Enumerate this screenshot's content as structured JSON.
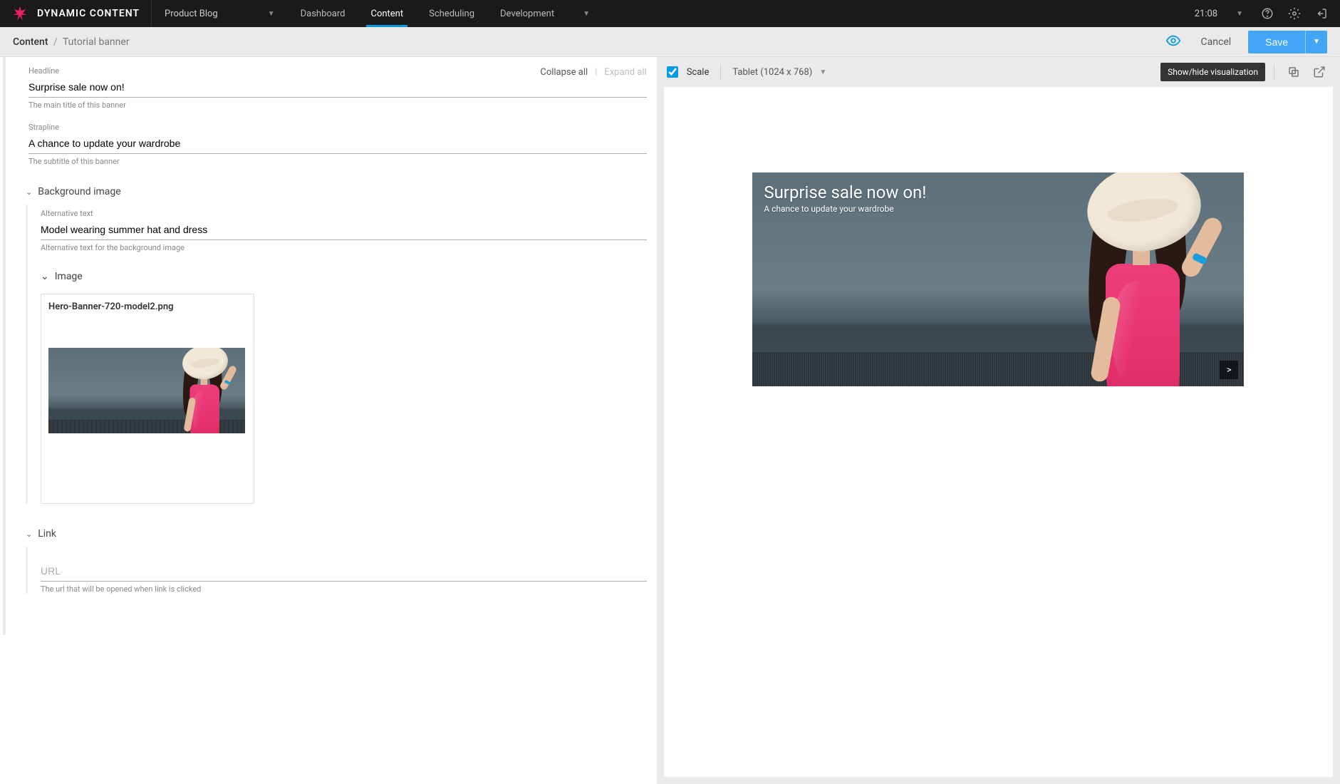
{
  "brand": "DYNAMIC CONTENT",
  "nav": {
    "workspace": "Product Blog",
    "tabs": [
      "Dashboard",
      "Content",
      "Scheduling",
      "Development"
    ],
    "active_tab": "Content"
  },
  "clock": "21:08",
  "breadcrumb": {
    "root": "Content",
    "leaf": "Tutorial banner"
  },
  "actions": {
    "cancel": "Cancel",
    "save": "Save"
  },
  "panel_controls": {
    "collapse": "Collapse all",
    "expand": "Expand all"
  },
  "fields": {
    "headline": {
      "label": "Headline",
      "value": "Surprise sale now on!",
      "help": "The main title of this banner"
    },
    "strapline": {
      "label": "Strapline",
      "value": "A chance to update your wardrobe",
      "help": "The subtitle of this banner"
    },
    "background_image": {
      "section_label": "Background image",
      "alt_text": {
        "label": "Alternative text",
        "value": "Model wearing summer hat and dress",
        "help": "Alternative text for the background image"
      },
      "image": {
        "section_label": "Image",
        "filename": "Hero-Banner-720-model2.png"
      }
    },
    "link": {
      "section_label": "Link",
      "url": {
        "placeholder": "URL",
        "value": "",
        "help": "The url that will be opened when link is clicked"
      }
    }
  },
  "preview": {
    "scale_label": "Scale",
    "scale_checked": true,
    "device": "Tablet (1024 x 768)",
    "tooltip": "Show/hide visualization",
    "banner_arrow": ">"
  }
}
